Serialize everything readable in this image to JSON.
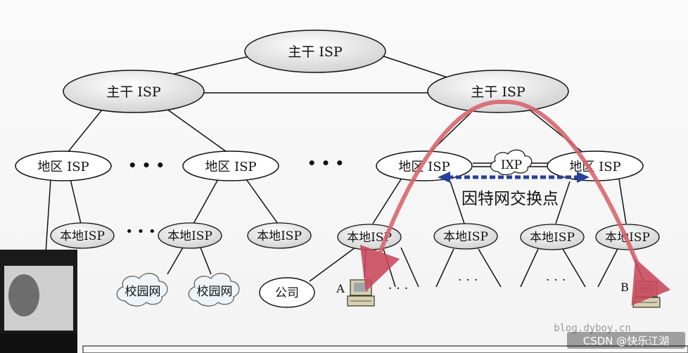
{
  "nodes": {
    "backbone_top": "主干 ISP",
    "backbone_left": "主干 ISP",
    "backbone_right": "主干 ISP",
    "regional_1": "地区 ISP",
    "regional_2": "地区 ISP",
    "regional_3": "地区 ISP",
    "regional_4": "地区 ISP",
    "local_1": "本地ISP",
    "local_2": "本地ISP",
    "local_3": "本地ISP",
    "local_4": "本地ISP",
    "local_5": "本地ISP",
    "local_6": "本地ISP",
    "local_7": "本地ISP",
    "campus_1": "校园网",
    "campus_2": "校园网",
    "company": "公司",
    "ixp": "IXP"
  },
  "labels": {
    "ixp_caption": "因特网交换点",
    "host_a": "A",
    "host_b": "B",
    "ellipsis_big": "• • •",
    "ellipsis_small": "• • •",
    "ellipsis_dots": "· · ·"
  },
  "watermarks": {
    "blog": "blog.dyboy.cn",
    "csdn": "CSDN @快乐江湖"
  },
  "colors": {
    "ellipse_fill": "#eeeeee",
    "ellipse_dark": "#d2d2d2",
    "path_red": "#d8646c",
    "ixp_blue": "#2a3f9a"
  }
}
